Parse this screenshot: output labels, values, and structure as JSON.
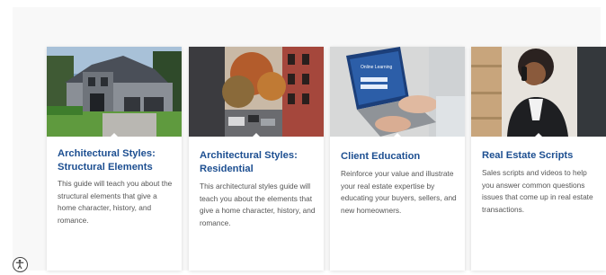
{
  "cards": [
    {
      "title": "Architectural Styles: Structural Elements",
      "description": "This guide will teach you about the structural elements that give a home character, history, and romance."
    },
    {
      "title": "Architectural Styles: Residential",
      "description": "This architectural styles guide will teach you about the elements that give a home character, history, and romance."
    },
    {
      "title": "Client Education",
      "description": "Reinforce your value and illustrate your real estate expertise by educating your buyers, sellers, and new homeowners."
    },
    {
      "title": "Real Estate Scripts",
      "description": "Sales scripts and videos to help you answer common questions issues that come up in real estate transactions."
    }
  ],
  "screen_text": {
    "laptop_heading": "Online Learning"
  },
  "colors": {
    "title": "#1d4f91",
    "text": "#555555",
    "panel": "#f8f8f8"
  }
}
